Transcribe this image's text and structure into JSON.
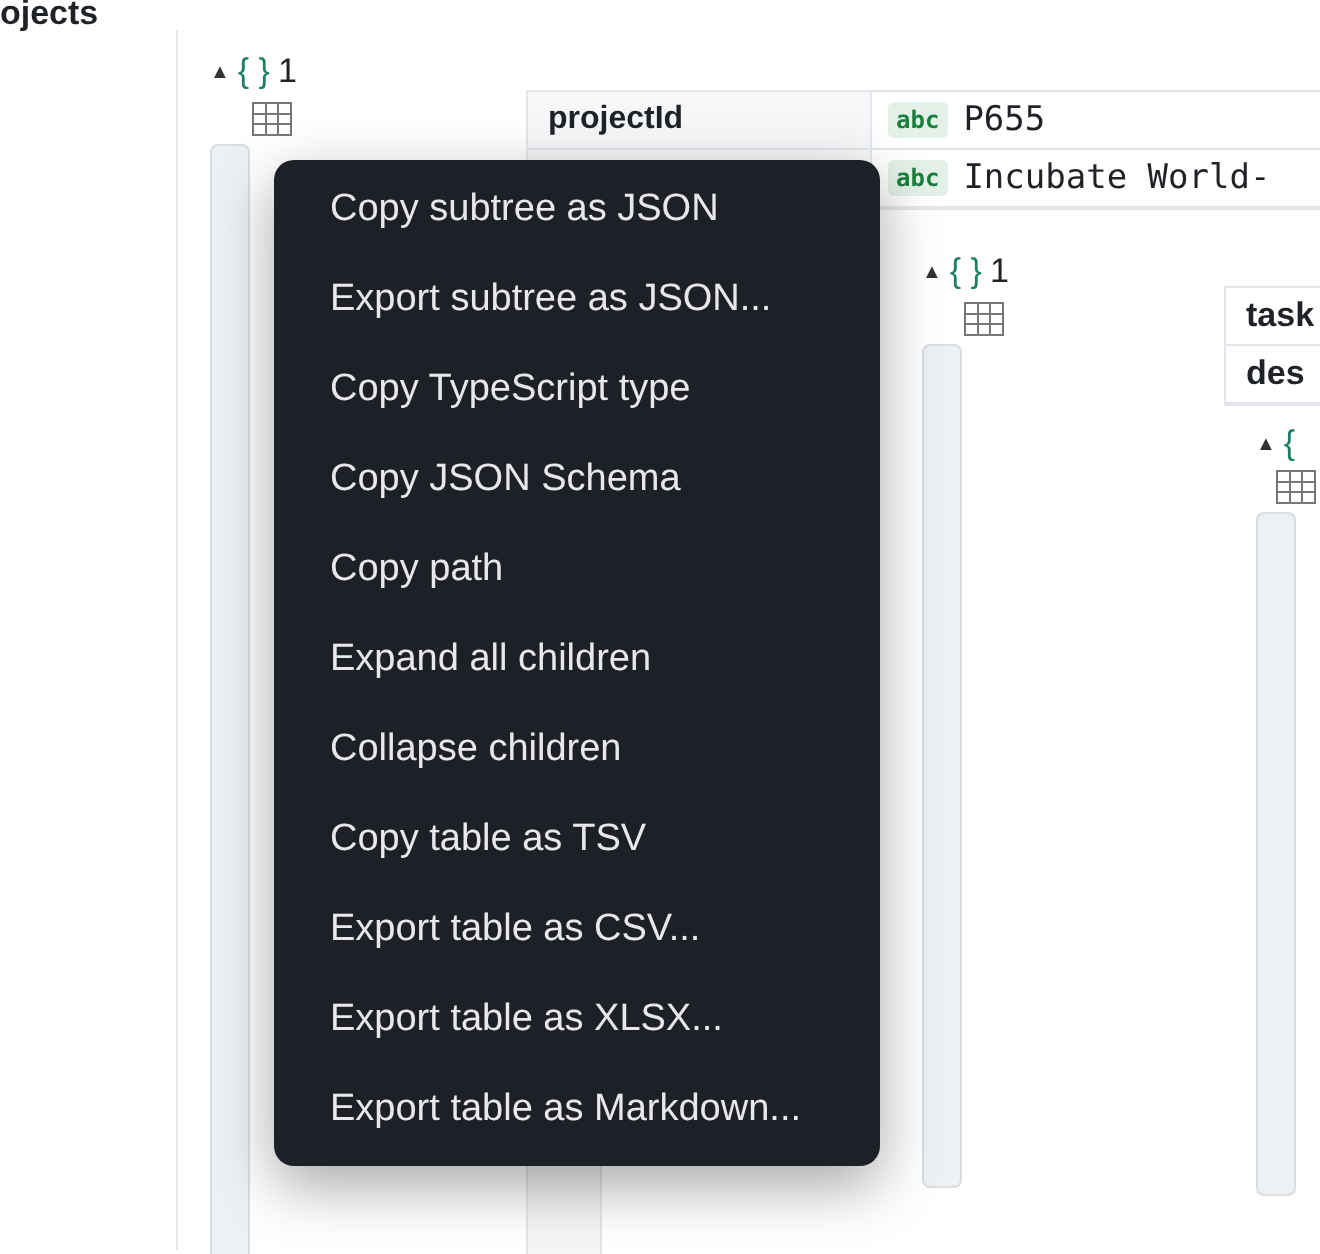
{
  "section_title": "ojects",
  "root": {
    "toggle": "▲",
    "brace": "{ }",
    "count": "1",
    "rows": [
      {
        "key": "projectId",
        "type": "abc",
        "value": "P655"
      },
      {
        "key": "",
        "type": "abc",
        "value": "Incubate World-"
      }
    ],
    "child": {
      "toggle": "▲",
      "brace": "{ }",
      "count": "1",
      "rows": [
        {
          "key": "task"
        },
        {
          "key": "des"
        }
      ],
      "child": {
        "toggle": "▲",
        "brace": "{"
      }
    }
  },
  "menu": [
    "Copy subtree as JSON",
    "Export subtree as JSON...",
    "Copy TypeScript type",
    "Copy JSON Schema",
    "Copy path",
    "Expand all children",
    "Collapse children",
    "Copy table as TSV",
    "Export table as CSV...",
    "Export table as XLSX...",
    "Export table as Markdown..."
  ]
}
